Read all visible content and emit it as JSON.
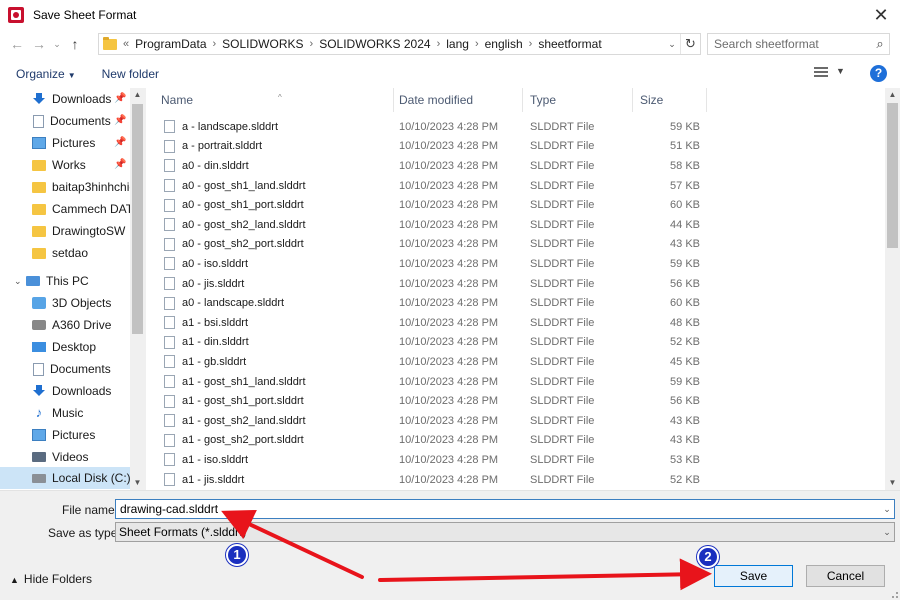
{
  "window": {
    "title": "Save Sheet Format",
    "close_glyph": "✕"
  },
  "navigation": {
    "back_glyph": "←",
    "forward_glyph": "→",
    "recent_glyph": "⌄",
    "up_glyph": "↑",
    "breadcrumb_prefix": "«",
    "breadcrumbs": [
      "ProgramData",
      "SOLIDWORKS",
      "SOLIDWORKS 2024",
      "lang",
      "english",
      "sheetformat"
    ],
    "search_placeholder": "Search sheetformat"
  },
  "toolbar": {
    "organize_label": "Organize",
    "new_folder_label": "New folder",
    "help_glyph": "?"
  },
  "sidebar": {
    "items": [
      {
        "label": "Downloads",
        "icon": "download-icon",
        "pinned": true
      },
      {
        "label": "Documents",
        "icon": "document-icon",
        "pinned": true
      },
      {
        "label": "Pictures",
        "icon": "pictures-icon",
        "pinned": true
      },
      {
        "label": "Works",
        "icon": "folder-icon",
        "pinned": true
      },
      {
        "label": "baitap3hinhchieu",
        "icon": "folder-icon",
        "pinned": false
      },
      {
        "label": "Cammech DATA",
        "icon": "folder-icon",
        "pinned": false
      },
      {
        "label": "DrawingtoSW",
        "icon": "folder-icon",
        "pinned": false
      },
      {
        "label": "setdao",
        "icon": "folder-icon",
        "pinned": false
      },
      {
        "label": "This PC",
        "icon": "this-pc-icon",
        "pinned": false
      },
      {
        "label": "3D Objects",
        "icon": "3d-objects-icon",
        "pinned": false
      },
      {
        "label": "A360 Drive",
        "icon": "a360-drive-icon",
        "pinned": false
      },
      {
        "label": "Desktop",
        "icon": "desktop-icon",
        "pinned": false
      },
      {
        "label": "Documents",
        "icon": "document-icon",
        "pinned": false
      },
      {
        "label": "Downloads",
        "icon": "download-icon",
        "pinned": false
      },
      {
        "label": "Music",
        "icon": "music-icon",
        "pinned": false
      },
      {
        "label": "Pictures",
        "icon": "pictures-icon",
        "pinned": false
      },
      {
        "label": "Videos",
        "icon": "videos-icon",
        "pinned": false
      },
      {
        "label": "Local Disk (C:)",
        "icon": "local-disk-icon",
        "pinned": false,
        "selected": true
      }
    ]
  },
  "columns": {
    "name": "Name",
    "date_modified": "Date modified",
    "type": "Type",
    "size": "Size"
  },
  "files": [
    {
      "name": "a - landscape.slddrt",
      "date": "10/10/2023 4:28 PM",
      "type": "SLDDRT File",
      "size": "59 KB"
    },
    {
      "name": "a - portrait.slddrt",
      "date": "10/10/2023 4:28 PM",
      "type": "SLDDRT File",
      "size": "51 KB"
    },
    {
      "name": "a0 - din.slddrt",
      "date": "10/10/2023 4:28 PM",
      "type": "SLDDRT File",
      "size": "58 KB"
    },
    {
      "name": "a0 - gost_sh1_land.slddrt",
      "date": "10/10/2023 4:28 PM",
      "type": "SLDDRT File",
      "size": "57 KB"
    },
    {
      "name": "a0 - gost_sh1_port.slddrt",
      "date": "10/10/2023 4:28 PM",
      "type": "SLDDRT File",
      "size": "60 KB"
    },
    {
      "name": "a0 - gost_sh2_land.slddrt",
      "date": "10/10/2023 4:28 PM",
      "type": "SLDDRT File",
      "size": "44 KB"
    },
    {
      "name": "a0 - gost_sh2_port.slddrt",
      "date": "10/10/2023 4:28 PM",
      "type": "SLDDRT File",
      "size": "43 KB"
    },
    {
      "name": "a0 - iso.slddrt",
      "date": "10/10/2023 4:28 PM",
      "type": "SLDDRT File",
      "size": "59 KB"
    },
    {
      "name": "a0 - jis.slddrt",
      "date": "10/10/2023 4:28 PM",
      "type": "SLDDRT File",
      "size": "56 KB"
    },
    {
      "name": "a0 - landscape.slddrt",
      "date": "10/10/2023 4:28 PM",
      "type": "SLDDRT File",
      "size": "60 KB"
    },
    {
      "name": "a1 - bsi.slddrt",
      "date": "10/10/2023 4:28 PM",
      "type": "SLDDRT File",
      "size": "48 KB"
    },
    {
      "name": "a1 - din.slddrt",
      "date": "10/10/2023 4:28 PM",
      "type": "SLDDRT File",
      "size": "52 KB"
    },
    {
      "name": "a1 - gb.slddrt",
      "date": "10/10/2023 4:28 PM",
      "type": "SLDDRT File",
      "size": "45 KB"
    },
    {
      "name": "a1 - gost_sh1_land.slddrt",
      "date": "10/10/2023 4:28 PM",
      "type": "SLDDRT File",
      "size": "59 KB"
    },
    {
      "name": "a1 - gost_sh1_port.slddrt",
      "date": "10/10/2023 4:28 PM",
      "type": "SLDDRT File",
      "size": "56 KB"
    },
    {
      "name": "a1 - gost_sh2_land.slddrt",
      "date": "10/10/2023 4:28 PM",
      "type": "SLDDRT File",
      "size": "43 KB"
    },
    {
      "name": "a1 - gost_sh2_port.slddrt",
      "date": "10/10/2023 4:28 PM",
      "type": "SLDDRT File",
      "size": "43 KB"
    },
    {
      "name": "a1 - iso.slddrt",
      "date": "10/10/2023 4:28 PM",
      "type": "SLDDRT File",
      "size": "53 KB"
    },
    {
      "name": "a1 - jis.slddrt",
      "date": "10/10/2023 4:28 PM",
      "type": "SLDDRT File",
      "size": "52 KB"
    }
  ],
  "form": {
    "filename_label": "File name:",
    "filename_value": "drawing-cad.slddrt",
    "savetype_label": "Save as type:",
    "savetype_value": "Sheet Formats (*.slddrt)",
    "hide_folders_label": "Hide Folders",
    "save_label": "Save",
    "cancel_label": "Cancel"
  },
  "annotations": {
    "arrow_color": "#e8141b",
    "badge_color": "#1a2fbf",
    "badges": [
      "1",
      "2"
    ]
  }
}
